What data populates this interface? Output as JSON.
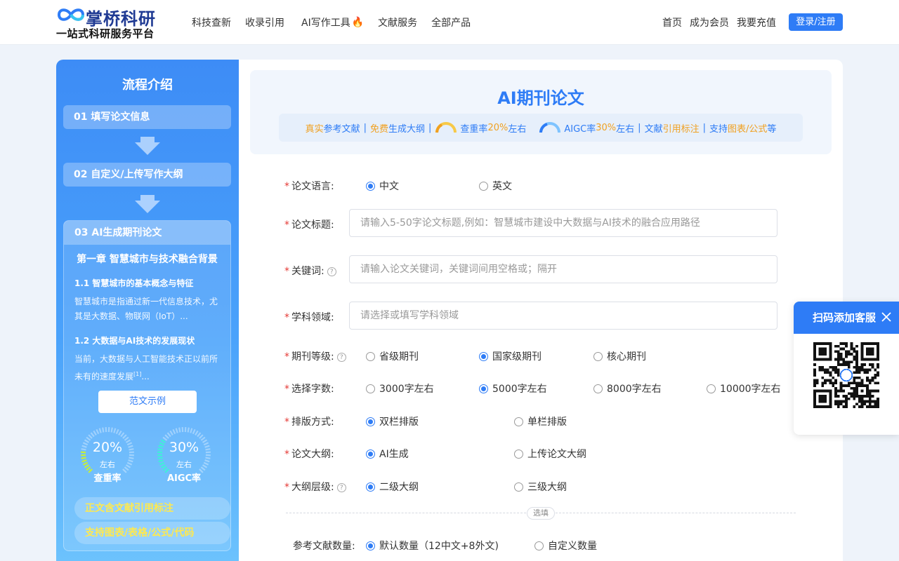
{
  "brand": {
    "name": "掌桥科研",
    "slogan": "一站式科研服务平台"
  },
  "nav": [
    "科技查新",
    "收录引用",
    "AI写作工具",
    "文献服务",
    "全部产品"
  ],
  "nav_hot_icon": "fire-icon",
  "right_nav": [
    "首页",
    "成为会员",
    "我要充值"
  ],
  "login_label": "登录/注册",
  "left": {
    "title": "流程介绍",
    "steps": [
      "01 填写论文信息",
      "02 自定义/上传写作大纲",
      "03 AI生成期刊论文"
    ],
    "preview": {
      "chapter": "第一章 智慧城市与技术融合背景",
      "s1_title": "1.1 智慧城市的基本概念与特征",
      "s1_text": "智慧城市是指通过新一代信息技术，尤其是大数据、物联网（IoT）...",
      "s2_title": "1.2 大数据与AI技术的发展现状",
      "s2_text": "当前，大数据与人工智能技术正以前所未有的速度发展",
      "s2_ref": "[1]",
      "s2_tail": "..."
    },
    "sample_btn": "范文示例",
    "gauges": [
      {
        "value": "20%",
        "sub": "左右",
        "label": "查重率",
        "level": 0.2,
        "color": "#c6ef3a"
      },
      {
        "value": "30%",
        "sub": "左右",
        "label": "AIGC率",
        "level": 0.3,
        "color": "#3ff0d8"
      }
    ],
    "features": [
      "正文含文献引用标注",
      "支持图表/表格/公式/代码"
    ]
  },
  "hero": {
    "title": "AI期刊论文",
    "bar": {
      "t1": "真实",
      "t2": "参考文献",
      "t3": "免费",
      "t4": "生成大纲",
      "t5": "查重率",
      "t6": "20%",
      "t7": "左右",
      "t8": "AIGC率",
      "t9": "30%",
      "t10": " 左右",
      "t11": "文献",
      "t12": "引用标注",
      "t13": "支持",
      "t14": "图表/公式",
      "t15": "等",
      "sep": "|"
    }
  },
  "form": {
    "language": {
      "label": "论文语言:",
      "options": [
        "中文",
        "英文"
      ],
      "selected": "中文"
    },
    "title": {
      "label": "论文标题:",
      "placeholder": "请输入5-50字论文标题,例如：智慧城市建设中大数据与AI技术的融合应用路径"
    },
    "keywords": {
      "label": "关键词:",
      "placeholder": "请输入论文关键词，关键词间用空格或；隔开"
    },
    "field": {
      "label": "学科领域:",
      "placeholder": "请选择或填写学科领域"
    },
    "level": {
      "label": "期刊等级:",
      "options": [
        "省级期刊",
        "国家级期刊",
        "核心期刊"
      ],
      "selected": "国家级期刊"
    },
    "words": {
      "label": "选择字数:",
      "options": [
        "3000字左右",
        "5000字左右",
        "8000字左右",
        "10000字左右"
      ],
      "selected": "5000字左右"
    },
    "layout": {
      "label": "排版方式:",
      "options": [
        "双栏排版",
        "单栏排版"
      ],
      "selected": "双栏排版"
    },
    "outline": {
      "label": "论文大纲:",
      "options": [
        "AI生成",
        "上传论文大纲"
      ],
      "selected": "AI生成"
    },
    "outline_level": {
      "label": "大纲层级:",
      "options": [
        "二级大纲",
        "三级大纲"
      ],
      "selected": "二级大纲"
    },
    "optional_label": "选填",
    "refs": {
      "label": "参考文献数量:",
      "options": [
        "默认数量（12中文+8外文)",
        "自定义数量"
      ],
      "selected": "默认数量（12中文+8外文)"
    }
  },
  "qr": {
    "title": "扫码添加客服"
  },
  "colors": {
    "accent": "#2e7cf6",
    "orange": "#f0a020",
    "required": "#e53935"
  }
}
